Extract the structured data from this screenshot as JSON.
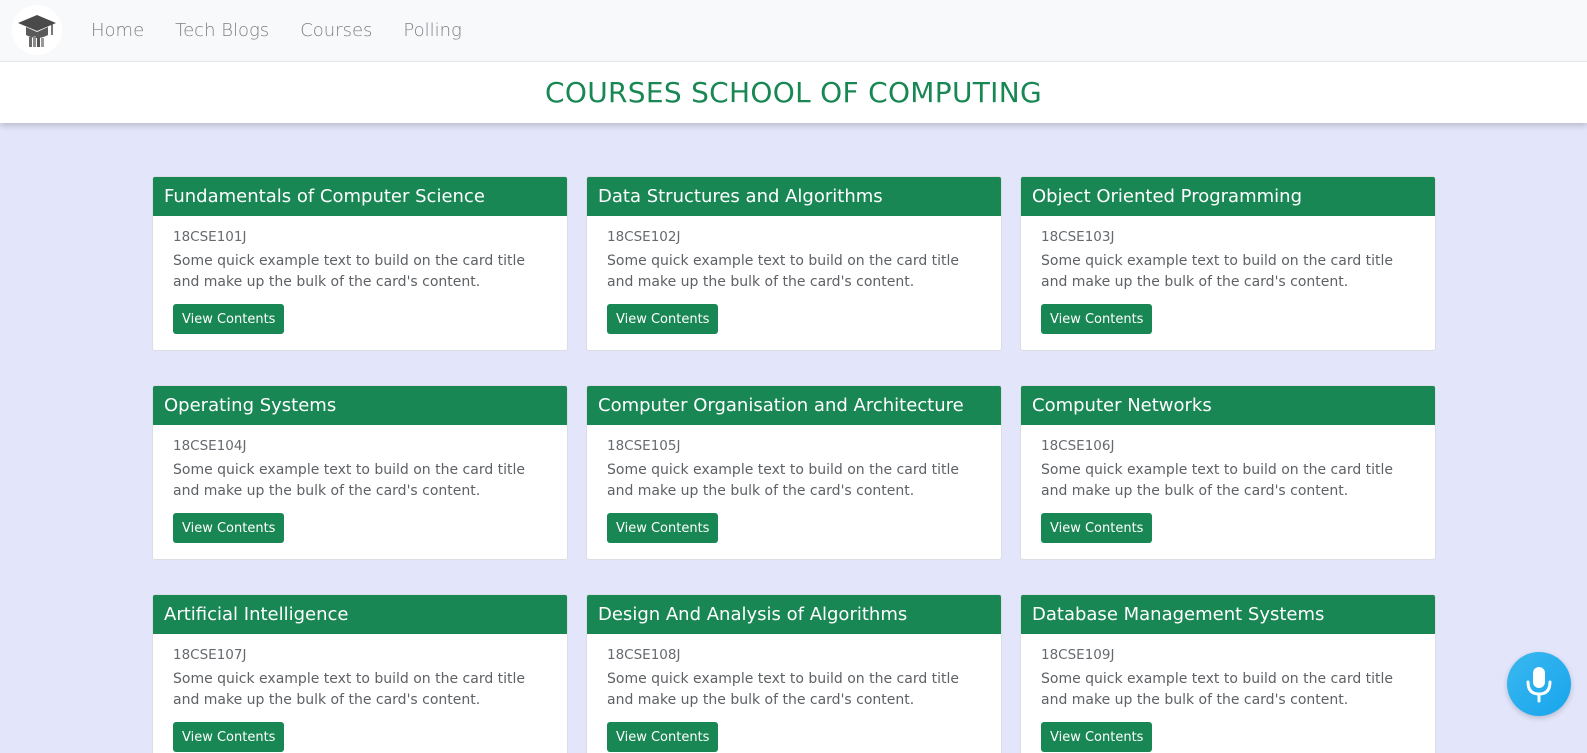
{
  "nav": {
    "items": [
      {
        "label": "Home"
      },
      {
        "label": "Tech Blogs"
      },
      {
        "label": "Courses"
      },
      {
        "label": "Polling"
      }
    ]
  },
  "page": {
    "title": "COURSES SCHOOL OF COMPUTING"
  },
  "colors": {
    "accent": "#198754",
    "background": "#e3e6fb",
    "mic": "#29b1ee"
  },
  "courses": [
    {
      "title": "Fundamentals of Computer Science",
      "code": "18CSE101J",
      "text": "Some quick example text to build on the card title and make up the bulk of the card's content.",
      "button": "View Contents"
    },
    {
      "title": "Data Structures and Algorithms",
      "code": "18CSE102J",
      "text": "Some quick example text to build on the card title and make up the bulk of the card's content.",
      "button": "View Contents"
    },
    {
      "title": "Object Oriented Programming",
      "code": "18CSE103J",
      "text": "Some quick example text to build on the card title and make up the bulk of the card's content.",
      "button": "View Contents"
    },
    {
      "title": "Operating Systems",
      "code": "18CSE104J",
      "text": "Some quick example text to build on the card title and make up the bulk of the card's content.",
      "button": "View Contents"
    },
    {
      "title": "Computer Organisation and Architecture",
      "code": "18CSE105J",
      "text": "Some quick example text to build on the card title and make up the bulk of the card's content.",
      "button": "View Contents"
    },
    {
      "title": "Computer Networks",
      "code": "18CSE106J",
      "text": "Some quick example text to build on the card title and make up the bulk of the card's content.",
      "button": "View Contents"
    },
    {
      "title": "Artificial Intelligence",
      "code": "18CSE107J",
      "text": "Some quick example text to build on the card title and make up the bulk of the card's content.",
      "button": "View Contents"
    },
    {
      "title": "Design And Analysis of Algorithms",
      "code": "18CSE108J",
      "text": "Some quick example text to build on the card title and make up the bulk of the card's content.",
      "button": "View Contents"
    },
    {
      "title": "Database Management Systems",
      "code": "18CSE109J",
      "text": "Some quick example text to build on the card title and make up the bulk of the card's content.",
      "button": "View Contents"
    }
  ],
  "icons": {
    "logo": "graduation-cap-icon",
    "mic": "microphone-icon"
  }
}
